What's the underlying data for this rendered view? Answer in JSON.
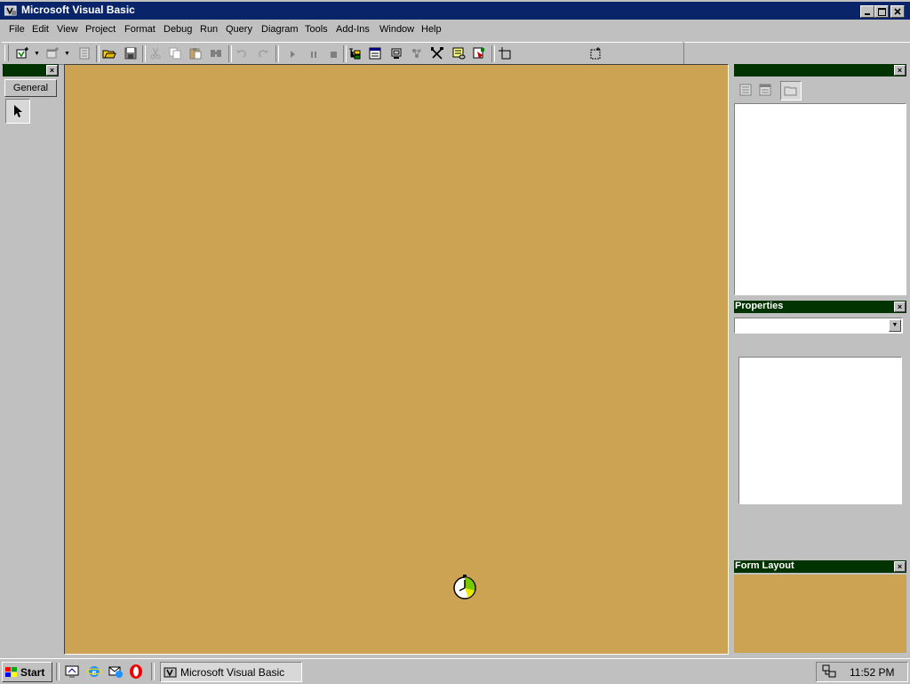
{
  "window": {
    "title": "Microsoft Visual Basic"
  },
  "menu": [
    "File",
    "Edit",
    "View",
    "Project",
    "Format",
    "Debug",
    "Run",
    "Query",
    "Diagram",
    "Tools",
    "Add-Ins",
    "Window",
    "Help"
  ],
  "toolbox": {
    "tab_label": "General"
  },
  "project_explorer": {},
  "properties": {
    "title": "Properties",
    "object_select": ""
  },
  "form_layout": {
    "title": "Form Layout"
  },
  "taskbar": {
    "start_label": "Start",
    "task_label": "Microsoft Visual Basic",
    "clock": "11:52 PM"
  },
  "colors": {
    "title_bar": "#0a246a",
    "panel_caption": "#003300",
    "workspace": "#cca352",
    "chrome": "#c0c0c0"
  },
  "icons": [
    "vb-app-icon",
    "add-project-icon",
    "add-form-icon",
    "menu-editor-icon",
    "open-project-icon",
    "save-project-icon",
    "cut-icon",
    "copy-icon",
    "paste-icon",
    "find-icon",
    "undo-icon",
    "redo-icon",
    "start-icon",
    "break-icon",
    "end-icon",
    "project-explorer-icon",
    "properties-window-icon",
    "form-layout-icon",
    "object-browser-icon",
    "toolbox-icon",
    "data-view-icon",
    "component-manager-icon",
    "pointer-icon",
    "hourglass-cursor-icon"
  ]
}
